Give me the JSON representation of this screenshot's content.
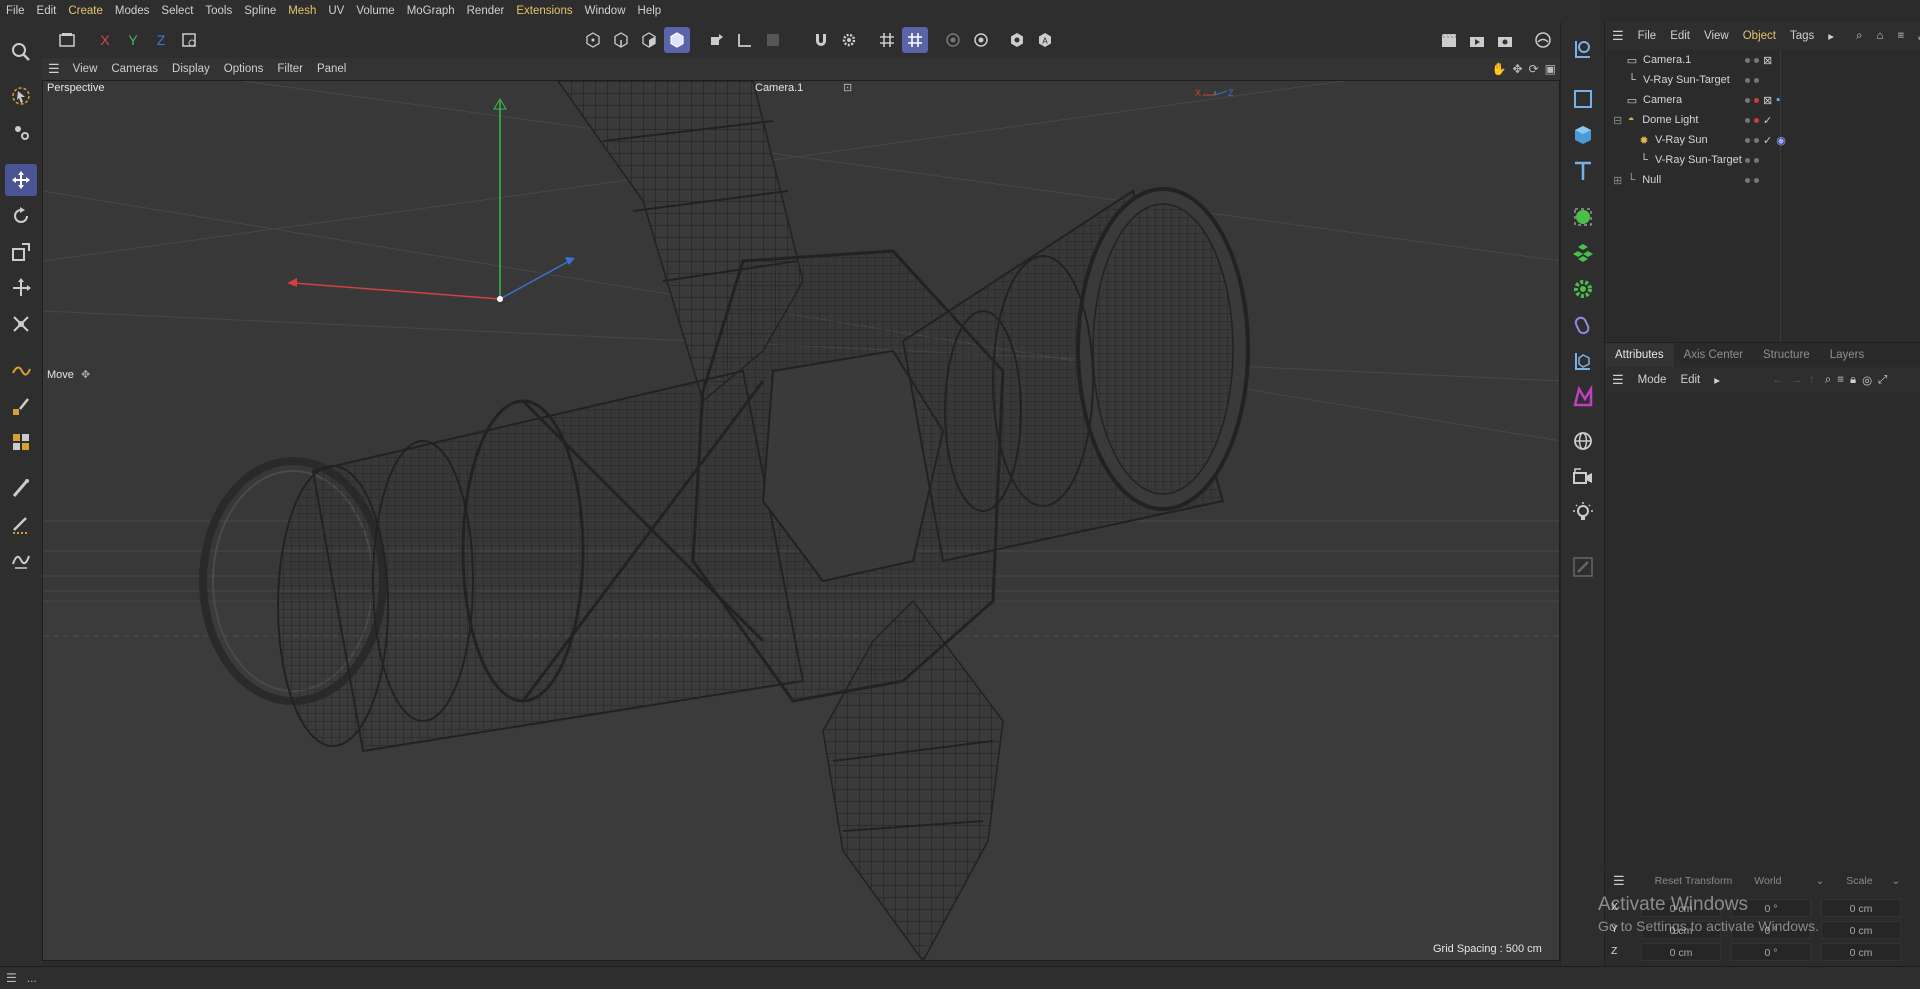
{
  "menubar": {
    "items": [
      "File",
      "Edit",
      "Create",
      "Modes",
      "Select",
      "Tools",
      "Spline",
      "Mesh",
      "UV",
      "Volume",
      "MoGraph",
      "Render",
      "Extensions",
      "Window",
      "Help"
    ],
    "highlighted": [
      "Create",
      "Mesh",
      "Extensions"
    ]
  },
  "toolbar": {
    "axis_x": "X",
    "axis_y": "Y",
    "axis_z": "Z"
  },
  "viewport": {
    "menu": [
      "View",
      "Cameras",
      "Display",
      "Options",
      "Filter",
      "Panel"
    ],
    "view_name": "Perspective",
    "camera_name": "Camera.1",
    "tool_label": "Move",
    "grid_spacing": "Grid Spacing : 500 cm",
    "axis_labels": {
      "x": "X",
      "y": "Y",
      "z": "Z"
    }
  },
  "object_manager": {
    "menu": [
      "File",
      "Edit",
      "View",
      "Object",
      "Tags"
    ],
    "selected_menu": "Object",
    "objects": [
      {
        "name": "Camera.1",
        "icon": "camera-icon",
        "depth": 0,
        "expand": false
      },
      {
        "name": "V-Ray Sun-Target",
        "icon": "target-icon",
        "depth": 0,
        "expand": false
      },
      {
        "name": "Camera",
        "icon": "camera-icon",
        "depth": 0,
        "expand": false
      },
      {
        "name": "Dome Light",
        "icon": "dome-light-icon",
        "depth": 0,
        "expand": true
      },
      {
        "name": "V-Ray Sun",
        "icon": "sun-icon",
        "depth": 1,
        "expand": false
      },
      {
        "name": "V-Ray Sun-Target",
        "icon": "target-icon",
        "depth": 1,
        "expand": false
      },
      {
        "name": "Null",
        "icon": "null-icon",
        "depth": 0,
        "expand": true
      }
    ]
  },
  "attributes": {
    "tabs": [
      "Attributes",
      "Axis Center",
      "Structure",
      "Layers"
    ],
    "selected_tab": "Attributes",
    "menu": [
      "Mode",
      "Edit"
    ]
  },
  "coordinates": {
    "reset_label": "Reset Transform",
    "space": "World",
    "mode": "Scale",
    "rows": [
      {
        "axis": "X",
        "pos": "0 cm",
        "rot": "0 °",
        "scale": "0 cm"
      },
      {
        "axis": "Y",
        "pos": "0 cm",
        "rot": "0 °",
        "scale": "0 cm"
      },
      {
        "axis": "Z",
        "pos": "0 cm",
        "rot": "0 °",
        "scale": "0 cm"
      }
    ]
  },
  "watermark": {
    "line1": "Activate Windows",
    "line2": "Go to Settings to activate Windows."
  },
  "statusbar": {
    "text": "..."
  },
  "colors": {
    "accent": "#5a64a8",
    "highlight_menu": "#e3c46a",
    "axis_x": "#d24a4a",
    "axis_y": "#4ab85a",
    "axis_z": "#3a78d8"
  }
}
